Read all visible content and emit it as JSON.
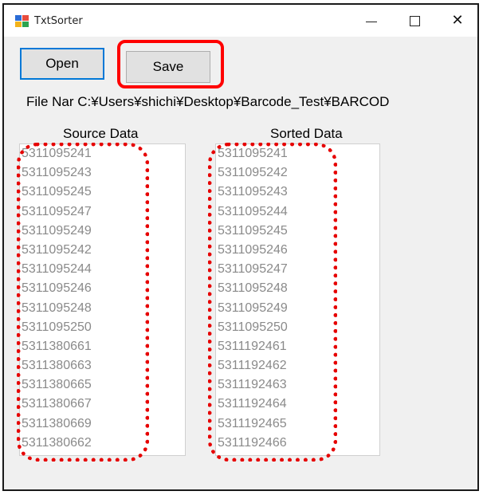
{
  "window": {
    "title": "TxtSorter",
    "icon": "app-window-icon",
    "controls": {
      "minimize_icon": "minimize-icon",
      "maximize_icon": "maximize-icon",
      "close_glyph": "✕"
    }
  },
  "toolbar": {
    "open_label": "Open",
    "save_label": "Save"
  },
  "file": {
    "label_text": "File Nar C:¥Users¥shichi¥Desktop¥Barcode_Test¥BARCOD"
  },
  "source": {
    "header": "Source Data",
    "items": [
      "5311095241",
      "5311095243",
      "5311095245",
      "5311095247",
      "5311095249",
      "5311095242",
      "5311095244",
      "5311095246",
      "5311095248",
      "5311095250",
      "5311380661",
      "5311380663",
      "5311380665",
      "5311380667",
      "5311380669",
      "5311380662"
    ]
  },
  "sorted": {
    "header": "Sorted Data",
    "items": [
      "5311095241",
      "5311095242",
      "5311095243",
      "5311095244",
      "5311095245",
      "5311095246",
      "5311095247",
      "5311095248",
      "5311095249",
      "5311095250",
      "5311192461",
      "5311192462",
      "5311192463",
      "5311192464",
      "5311192465",
      "5311192466"
    ]
  },
  "annotations": {
    "highlight_color": "#ff0000",
    "dotted_color": "#e60000"
  }
}
